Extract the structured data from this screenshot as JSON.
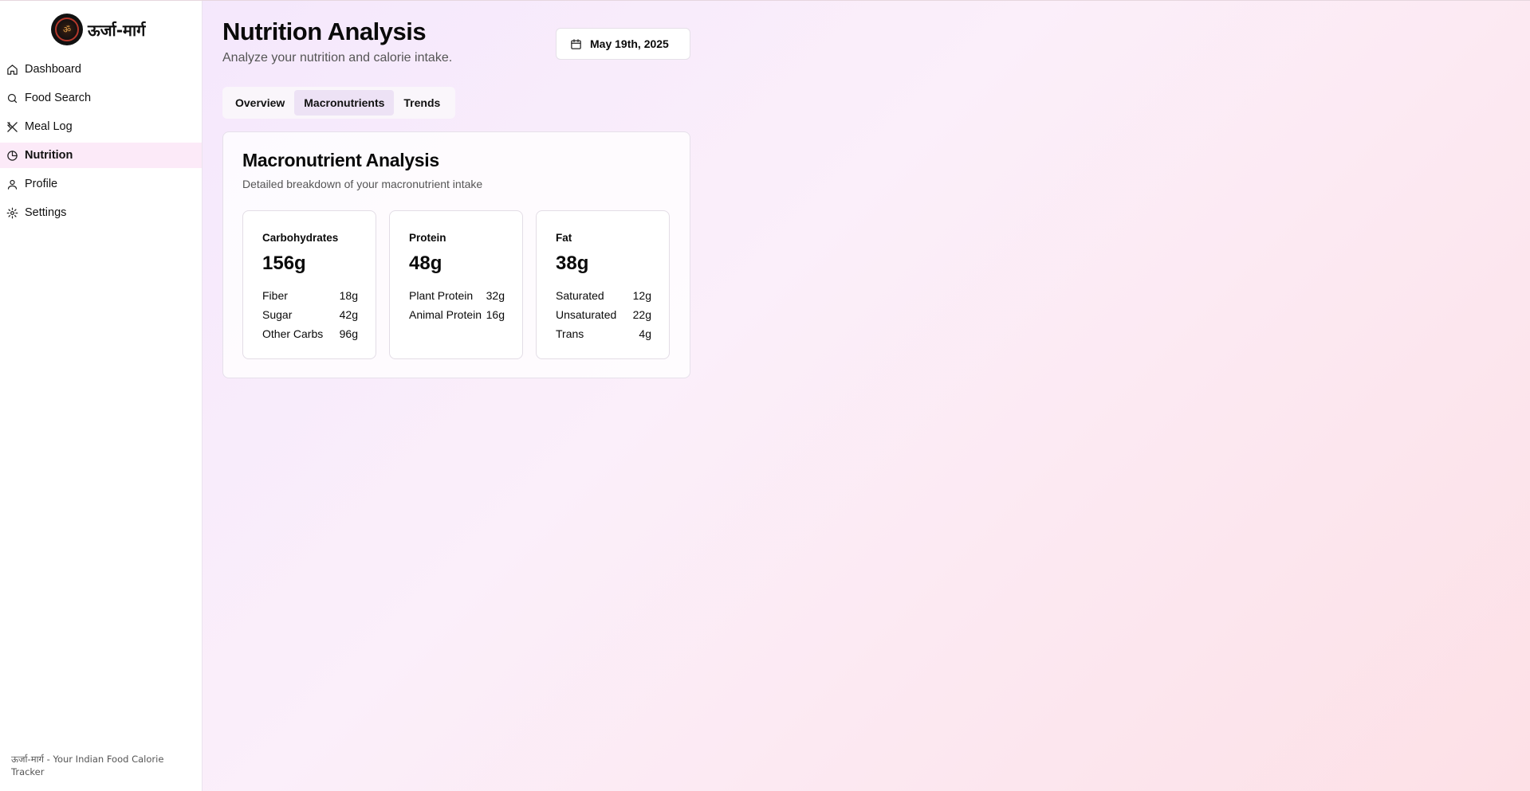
{
  "app": {
    "brand_name": "ऊर्जा-मार्ग",
    "logo_glyph": "ॐ",
    "footer_text": "ऊर्जा-मार्ग - Your Indian Food Calorie Tracker",
    "accent_color": "#fceaf8"
  },
  "sidebar": {
    "items": [
      {
        "label": "Dashboard",
        "icon": "home-icon"
      },
      {
        "label": "Food Search",
        "icon": "search-icon"
      },
      {
        "label": "Meal Log",
        "icon": "utensils-icon"
      },
      {
        "label": "Nutrition",
        "icon": "pie-chart-icon",
        "active": true
      },
      {
        "label": "Profile",
        "icon": "user-icon"
      },
      {
        "label": "Settings",
        "icon": "gear-icon"
      }
    ]
  },
  "header": {
    "title": "Nutrition Analysis",
    "subtitle": "Analyze your nutrition and calorie intake.",
    "date_label": "May 19th, 2025"
  },
  "tabs": [
    {
      "label": "Overview"
    },
    {
      "label": "Macronutrients",
      "active": true
    },
    {
      "label": "Trends"
    }
  ],
  "card": {
    "title": "Macronutrient Analysis",
    "description": "Detailed breakdown of your macronutrient intake",
    "macros": [
      {
        "name": "Carbohydrates",
        "total": "156g",
        "rows": [
          {
            "label": "Fiber",
            "value": "18g"
          },
          {
            "label": "Sugar",
            "value": "42g"
          },
          {
            "label": "Other Carbs",
            "value": "96g"
          }
        ]
      },
      {
        "name": "Protein",
        "total": "48g",
        "rows": [
          {
            "label": "Plant Protein",
            "value": "32g"
          },
          {
            "label": "Animal Protein",
            "value": "16g"
          }
        ]
      },
      {
        "name": "Fat",
        "total": "38g",
        "rows": [
          {
            "label": "Saturated",
            "value": "12g"
          },
          {
            "label": "Unsaturated",
            "value": "22g"
          },
          {
            "label": "Trans",
            "value": "4g"
          }
        ]
      }
    ]
  }
}
